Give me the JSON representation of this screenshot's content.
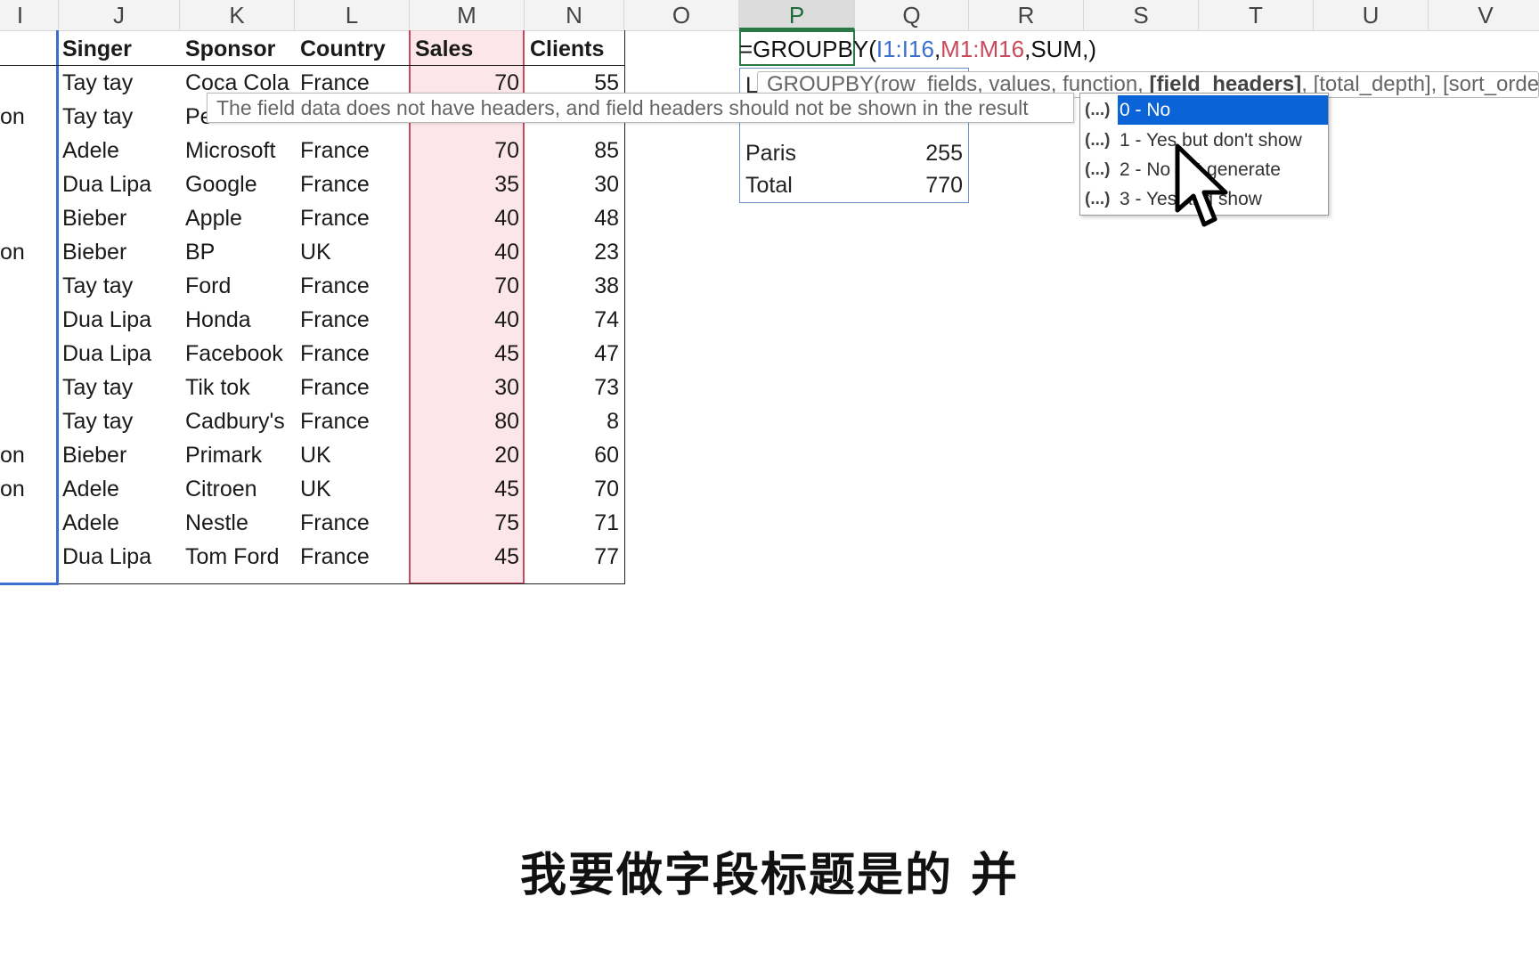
{
  "columns": [
    "I",
    "J",
    "K",
    "L",
    "M",
    "N",
    "O",
    "P",
    "Q",
    "R",
    "S",
    "T",
    "U",
    "V"
  ],
  "active_column": "P",
  "table": {
    "headers": {
      "singer": "Singer",
      "sponsor": "Sponsor",
      "country": "Country",
      "sales": "Sales",
      "clients": "Clients"
    },
    "left_clip": [
      "",
      "",
      "on",
      "",
      "",
      "",
      "on",
      "",
      "",
      "",
      "",
      "",
      "on",
      "on",
      "",
      ""
    ],
    "rows": [
      {
        "singer": "Tay tay",
        "sponsor": "Coca Cola",
        "country": "France",
        "sales": "70",
        "clients": "55"
      },
      {
        "singer": "Tay tay",
        "sponsor": "Pe",
        "country": "",
        "sales": "",
        "clients": ""
      },
      {
        "singer": "Adele",
        "sponsor": "Microsoft",
        "country": "France",
        "sales": "70",
        "clients": "85"
      },
      {
        "singer": "Dua Lipa",
        "sponsor": "Google",
        "country": "France",
        "sales": "35",
        "clients": "30"
      },
      {
        "singer": "Bieber",
        "sponsor": "Apple",
        "country": "France",
        "sales": "40",
        "clients": "48"
      },
      {
        "singer": "Bieber",
        "sponsor": "BP",
        "country": "UK",
        "sales": "40",
        "clients": "23"
      },
      {
        "singer": "Tay tay",
        "sponsor": "Ford",
        "country": "France",
        "sales": "70",
        "clients": "38"
      },
      {
        "singer": "Dua Lipa",
        "sponsor": "Honda",
        "country": "France",
        "sales": "40",
        "clients": "74"
      },
      {
        "singer": "Dua Lipa",
        "sponsor": "Facebook",
        "country": "France",
        "sales": "45",
        "clients": "47"
      },
      {
        "singer": "Tay tay",
        "sponsor": "Tik tok",
        "country": "France",
        "sales": "30",
        "clients": "73"
      },
      {
        "singer": "Tay tay",
        "sponsor": "Cadbury's",
        "country": "France",
        "sales": "80",
        "clients": "8"
      },
      {
        "singer": "Bieber",
        "sponsor": "Primark",
        "country": "UK",
        "sales": "20",
        "clients": "60"
      },
      {
        "singer": "Adele",
        "sponsor": "Citroen",
        "country": "UK",
        "sales": "45",
        "clients": "70"
      },
      {
        "singer": "Adele",
        "sponsor": "Nestle",
        "country": "France",
        "sales": "75",
        "clients": "71"
      },
      {
        "singer": "Dua Lipa",
        "sponsor": "Tom Ford",
        "country": "France",
        "sales": "45",
        "clients": "77"
      }
    ]
  },
  "formula": {
    "prefix": "=GROUPBY(",
    "ref1": "I1:I16",
    "sep1": ",",
    "ref2": "M1:M16",
    "rest": ",SUM,)"
  },
  "result": {
    "partial_label": "L",
    "rows": [
      {
        "label": "Paris",
        "value": "255"
      },
      {
        "label": "Total",
        "value": "770"
      }
    ]
  },
  "signature_tip": {
    "start": "GROUPBY(row_fields, values, function, ",
    "bold": "[field_headers]",
    "end": ", [total_depth], [sort_order],"
  },
  "description_tip": "The field data does not have headers, and field headers should not be shown in the result",
  "dropdown": {
    "icon": "(...)",
    "items": [
      "0 - No",
      "1 - Yes but don't show",
      "2 - No but generate",
      "3 - Yes and show"
    ]
  },
  "subtitle": "我要做字段标题是的 并"
}
